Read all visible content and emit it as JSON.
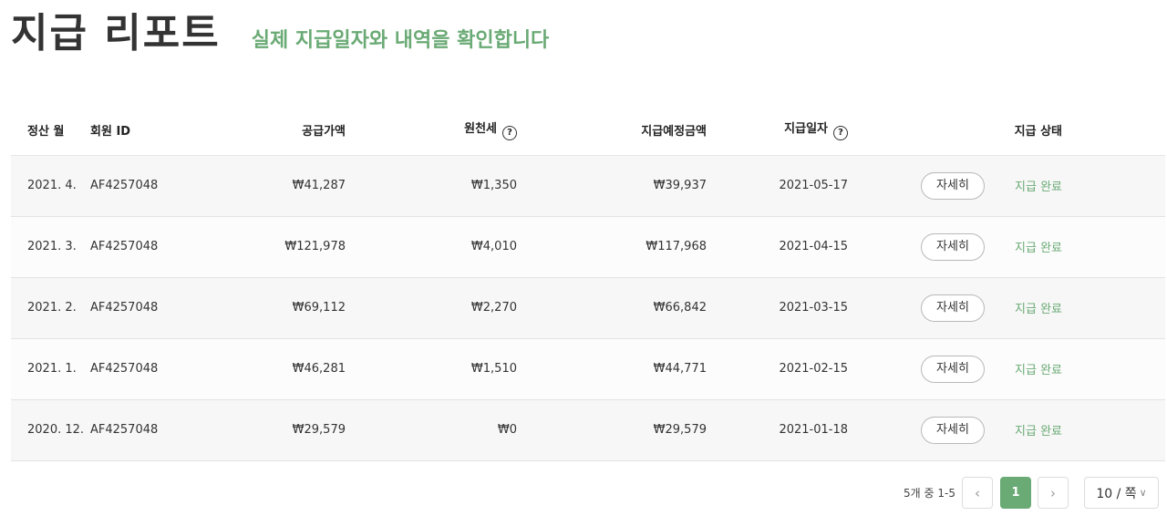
{
  "header": {
    "title": "지급 리포트",
    "subtitle": "실제 지급일자와 내역을 확인합니다"
  },
  "table": {
    "columns": {
      "month": "정산 월",
      "member_id": "회원 ID",
      "supply_amount": "공급가액",
      "withholding_tax": "원천세",
      "expected_amount": "지급예정금액",
      "payment_date": "지급일자",
      "status": "지급 상태"
    },
    "help_icon": "?",
    "rows": [
      {
        "month": "2021. 4.",
        "member_id": "AF4257048",
        "supply_amount": "₩41,287",
        "withholding_tax": "₩1,350",
        "expected_amount": "₩39,937",
        "payment_date": "2021-05-17",
        "detail_label": "자세히",
        "status": "지급 완료"
      },
      {
        "month": "2021. 3.",
        "member_id": "AF4257048",
        "supply_amount": "₩121,978",
        "withholding_tax": "₩4,010",
        "expected_amount": "₩117,968",
        "payment_date": "2021-04-15",
        "detail_label": "자세히",
        "status": "지급 완료"
      },
      {
        "month": "2021. 2.",
        "member_id": "AF4257048",
        "supply_amount": "₩69,112",
        "withholding_tax": "₩2,270",
        "expected_amount": "₩66,842",
        "payment_date": "2021-03-15",
        "detail_label": "자세히",
        "status": "지급 완료"
      },
      {
        "month": "2021. 1.",
        "member_id": "AF4257048",
        "supply_amount": "₩46,281",
        "withholding_tax": "₩1,510",
        "expected_amount": "₩44,771",
        "payment_date": "2021-02-15",
        "detail_label": "자세히",
        "status": "지급 완료"
      },
      {
        "month": "2020. 12.",
        "member_id": "AF4257048",
        "supply_amount": "₩29,579",
        "withholding_tax": "₩0",
        "expected_amount": "₩29,579",
        "payment_date": "2021-01-18",
        "detail_label": "자세히",
        "status": "지급 완료"
      }
    ]
  },
  "pagination": {
    "summary": "5개 중 1-5",
    "prev_icon": "‹",
    "current_page": "1",
    "next_icon": "›",
    "page_size": "10 / 쪽",
    "page_size_chevron": "∨"
  },
  "colors": {
    "accent": "#6aaa75",
    "row_bg": "#f7f7f7"
  }
}
